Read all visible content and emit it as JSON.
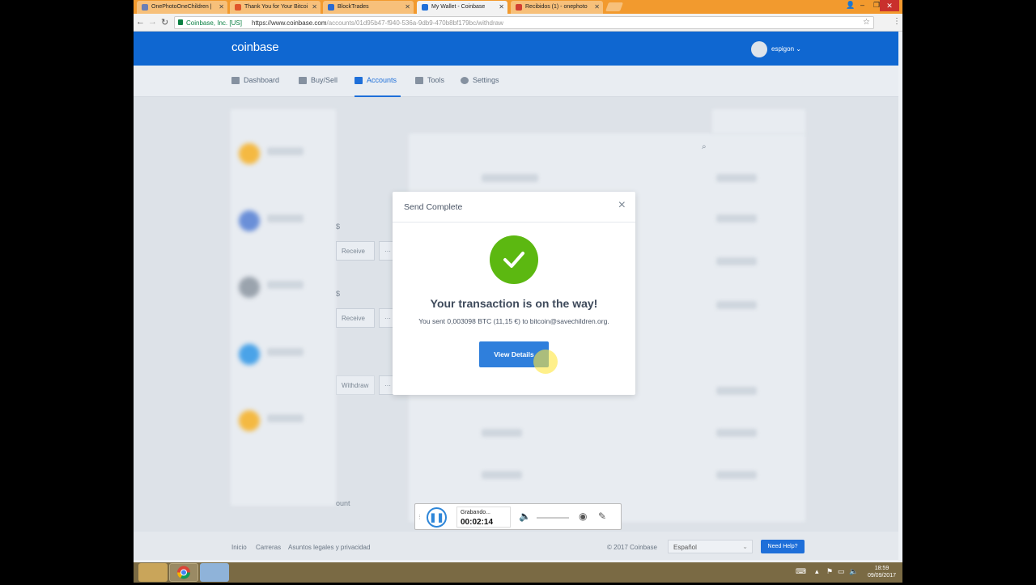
{
  "browser": {
    "tabs": [
      {
        "label": "OnePhotoOneChildren |",
        "color": "#6a7fb5"
      },
      {
        "label": "Thank You for Your Bitcoi",
        "color": "#e0552b"
      },
      {
        "label": "BlockTrades",
        "color": "#2a6ad0"
      },
      {
        "label": "My Wallet - Coinbase",
        "color": "#1e6fd9",
        "active": true
      },
      {
        "label": "Recibidos (1) - onephoto",
        "color": "#d23f31"
      }
    ],
    "secure_label": "Coinbase, Inc. [US]",
    "url_host": "https://www.coinbase.com",
    "url_path": "/accounts/01d95b47-f940-536a-9db9-470b8bf179bc/withdraw"
  },
  "header": {
    "logo": "coinbase",
    "username": "espigon ⌄"
  },
  "nav": [
    {
      "label": "Dashboard"
    },
    {
      "label": "Buy/Sell"
    },
    {
      "label": "Accounts",
      "active": true
    },
    {
      "label": "Tools"
    },
    {
      "label": "Settings"
    }
  ],
  "background": {
    "receive_label_1": "Receive",
    "receive_label_2": "Receive",
    "withdraw_label": "Withdraw",
    "account_fragment": "ount",
    "dollar_1": "$",
    "dollar_2": "$"
  },
  "modal": {
    "title": "Send Complete",
    "close": "×",
    "headline": "Your transaction is on the way!",
    "message": "You sent 0,003098 BTC (11,15 €) to bitcoin@savechildren.org.",
    "button": "View Details"
  },
  "footer": {
    "links": [
      "Inicio",
      "Carreras",
      "Asuntos legales y privacidad"
    ],
    "copyright": "© 2017 Coinbase",
    "language": "Español",
    "help": "Need Help?"
  },
  "recorder": {
    "status": "Grabando...",
    "time": "00:02:14"
  },
  "taskbar": {
    "time": "18:59",
    "date": "09/09/2017"
  }
}
